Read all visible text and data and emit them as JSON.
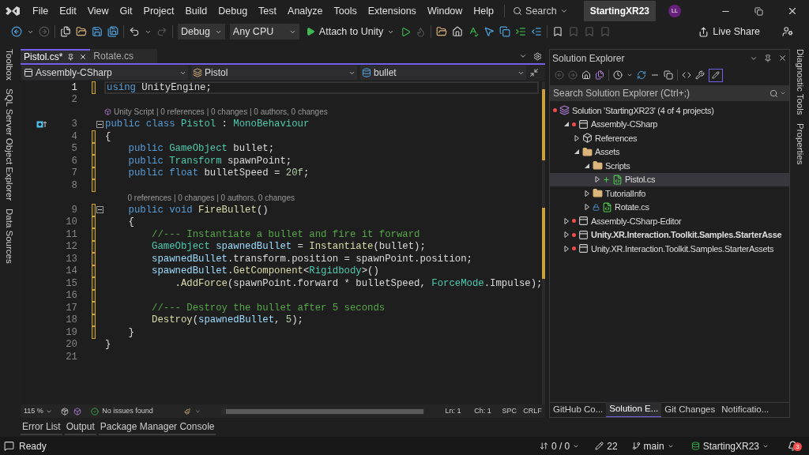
{
  "menu": [
    {
      "label": "File"
    },
    {
      "label": "Edit"
    },
    {
      "label": "View"
    },
    {
      "label": "Git"
    },
    {
      "label": "Project"
    },
    {
      "label": "Build"
    },
    {
      "label": "Debug"
    },
    {
      "label": "Test"
    },
    {
      "label": "Analyze"
    },
    {
      "label": "Tools"
    },
    {
      "label": "Extensions"
    },
    {
      "label": "Window"
    },
    {
      "label": "Help"
    }
  ],
  "search": {
    "label": "Search"
  },
  "solution_name": "StartingXR23",
  "avatar": "LL",
  "toolbar": {
    "configuration": "Debug",
    "platform": "Any CPU",
    "run": "Attach to Unity",
    "live_share": "Live Share"
  },
  "left_tool_tabs": [
    {
      "label": "Toolbox"
    },
    {
      "label": "SQL Server Object Explorer"
    },
    {
      "label": "Data Sources"
    }
  ],
  "right_tool_tabs": [
    {
      "label": "Diagnostic Tools"
    },
    {
      "label": "Properties"
    }
  ],
  "editor": {
    "tabs": [
      {
        "label": "Pistol.cs*",
        "selected": true
      },
      {
        "label": "Rotate.cs",
        "selected": false
      }
    ],
    "nav": {
      "project": "Assembly-CSharp",
      "type": "Pistol",
      "member": "bullet"
    },
    "lines": [
      {
        "n": "1",
        "changed": true,
        "fold": false,
        "current": true,
        "marker": false,
        "tokens": [
          {
            "text": "using",
            "kind": "kw"
          },
          {
            "text": " UnityEngine;",
            "kind": "plain"
          }
        ]
      },
      {
        "n": "2",
        "changed": false,
        "fold": false,
        "current": false,
        "marker": false
      },
      {
        "n": "3",
        "changed": false,
        "fold": true,
        "current": false,
        "marker": true,
        "lens": {
          "text": "Unity Script | 0 references | 0 changes | 0 authors, 0 changes",
          "kind": "unity"
        },
        "tokens": [
          {
            "text": "public class",
            "kind": "kw"
          },
          {
            "text": " Pistol",
            "kind": "type"
          },
          {
            "text": " : ",
            "kind": "plain"
          },
          {
            "text": "MonoBehaviour",
            "kind": "type"
          }
        ]
      },
      {
        "n": "4",
        "changed": true,
        "fold": false,
        "current": false,
        "marker": false,
        "tokens": [
          {
            "text": "{",
            "kind": "plain"
          }
        ]
      },
      {
        "n": "5",
        "changed": true,
        "fold": false,
        "current": false,
        "marker": false,
        "tokens": [
          {
            "text": "    public",
            "kind": "kw"
          },
          {
            "text": " GameObject",
            "kind": "type"
          },
          {
            "text": " bullet;",
            "kind": "plain"
          }
        ]
      },
      {
        "n": "6",
        "changed": true,
        "fold": false,
        "current": false,
        "marker": false,
        "tokens": [
          {
            "text": "    public",
            "kind": "kw"
          },
          {
            "text": " Transform",
            "kind": "type"
          },
          {
            "text": " spawnPoint;",
            "kind": "plain"
          }
        ]
      },
      {
        "n": "7",
        "changed": true,
        "fold": false,
        "current": false,
        "marker": false,
        "tokens": [
          {
            "text": "    public float",
            "kind": "kw"
          },
          {
            "text": " bulletSpeed = ",
            "kind": "plain"
          },
          {
            "text": "20f",
            "kind": "num"
          },
          {
            "text": ";",
            "kind": "plain"
          }
        ]
      },
      {
        "n": "8",
        "changed": true,
        "fold": false,
        "current": false,
        "marker": false
      },
      {
        "n": "9",
        "changed": true,
        "fold": true,
        "current": false,
        "marker": false,
        "lens": {
          "text": "0 references | 0 changes | 0 authors, 0 changes",
          "kind": "plain"
        },
        "tokens": [
          {
            "text": "    public void",
            "kind": "kw"
          },
          {
            "text": " FireBullet",
            "kind": "method"
          },
          {
            "text": "()",
            "kind": "plain"
          }
        ]
      },
      {
        "n": "10",
        "changed": true,
        "fold": false,
        "current": false,
        "marker": false,
        "tokens": [
          {
            "text": "    {",
            "kind": "plain"
          }
        ]
      },
      {
        "n": "11",
        "changed": true,
        "fold": false,
        "current": false,
        "marker": false,
        "tokens": [
          {
            "text": "        //--- Instantiate a bullet and fire it forward",
            "kind": "comment"
          }
        ]
      },
      {
        "n": "12",
        "changed": true,
        "fold": false,
        "current": false,
        "marker": false,
        "tokens": [
          {
            "text": "        GameObject",
            "kind": "type"
          },
          {
            "text": " spawnedBullet",
            "kind": "var"
          },
          {
            "text": " = ",
            "kind": "plain"
          },
          {
            "text": "Instantiate",
            "kind": "method"
          },
          {
            "text": "(bullet);",
            "kind": "plain"
          }
        ]
      },
      {
        "n": "13",
        "changed": true,
        "fold": false,
        "current": false,
        "marker": false,
        "tokens": [
          {
            "text": "        spawnedBullet",
            "kind": "var"
          },
          {
            "text": ".transform.position = spawnPoint.position;",
            "kind": "plain"
          }
        ]
      },
      {
        "n": "14",
        "changed": true,
        "fold": false,
        "current": false,
        "marker": false,
        "tokens": [
          {
            "text": "        spawnedBullet",
            "kind": "var"
          },
          {
            "text": ".",
            "kind": "plain"
          },
          {
            "text": "GetComponent",
            "kind": "method"
          },
          {
            "text": "<",
            "kind": "plain"
          },
          {
            "text": "Rigidbody",
            "kind": "type"
          },
          {
            "text": ">()",
            "kind": "plain"
          }
        ]
      },
      {
        "n": "15",
        "changed": true,
        "fold": false,
        "current": false,
        "marker": false,
        "tokens": [
          {
            "text": "            .",
            "kind": "plain"
          },
          {
            "text": "AddForce",
            "kind": "method"
          },
          {
            "text": "(spawnPoint.forward * bulletSpeed, ",
            "kind": "plain"
          },
          {
            "text": "ForceMode",
            "kind": "type"
          },
          {
            "text": ".Impulse);",
            "kind": "plain"
          }
        ]
      },
      {
        "n": "16",
        "changed": true,
        "fold": false,
        "current": false,
        "marker": false
      },
      {
        "n": "17",
        "changed": true,
        "fold": false,
        "current": false,
        "marker": false,
        "tokens": [
          {
            "text": "        //--- Destroy the bullet after 5 seconds",
            "kind": "comment"
          }
        ]
      },
      {
        "n": "18",
        "changed": true,
        "fold": false,
        "current": false,
        "marker": false,
        "tokens": [
          {
            "text": "        Destroy",
            "kind": "method"
          },
          {
            "text": "(",
            "kind": "plain"
          },
          {
            "text": "spawnedBullet",
            "kind": "var"
          },
          {
            "text": ", ",
            "kind": "plain"
          },
          {
            "text": "5",
            "kind": "num"
          },
          {
            "text": ");",
            "kind": "plain"
          }
        ]
      },
      {
        "n": "19",
        "changed": true,
        "fold": false,
        "current": false,
        "marker": false,
        "tokens": [
          {
            "text": "    }",
            "kind": "plain"
          }
        ]
      },
      {
        "n": "20",
        "changed": false,
        "fold": false,
        "current": false,
        "marker": false,
        "tokens": [
          {
            "text": "}",
            "kind": "plain"
          }
        ]
      },
      {
        "n": "21",
        "changed": false,
        "fold": false,
        "current": false,
        "marker": false
      }
    ],
    "status": {
      "zoom": "115 %",
      "issues": "No issues found",
      "line": "Ln: 1",
      "column": "Ch: 1",
      "whitespace": "SPC",
      "line_endings": "CRLF"
    }
  },
  "solution_explorer": {
    "title": "Solution Explorer",
    "search": {
      "placeholder": "Search Solution Explorer (Ctrl+;)"
    },
    "tree": [
      {
        "label": "Solution 'StartingXR23' (4 of 4 projects)",
        "kind": "solution",
        "pending": true,
        "selected": false,
        "children": [
          {
            "label": "Assembly-CSharp",
            "kind": "project",
            "pending": true,
            "bold": false,
            "expanded": true,
            "selected": false,
            "children": [
              {
                "label": "References",
                "kind": "references",
                "expanded": false,
                "selected": false
              },
              {
                "label": "Assets",
                "kind": "folder",
                "expanded": true,
                "selected": false,
                "children": [
                  {
                    "label": "Scripts",
                    "kind": "folder",
                    "expanded": true,
                    "selected": false,
                    "children": [
                      {
                        "label": "Pistol.cs",
                        "kind": "csharp",
                        "added": true,
                        "locked": false,
                        "expanded": false,
                        "selected": true
                      }
                    ]
                  },
                  {
                    "label": "TutorialInfo",
                    "kind": "folder",
                    "expanded": false,
                    "selected": false
                  },
                  {
                    "label": "Rotate.cs",
                    "kind": "csharp",
                    "added": false,
                    "locked": true,
                    "expanded": false,
                    "selected": false
                  }
                ]
              }
            ]
          },
          {
            "label": "Assembly-CSharp-Editor",
            "kind": "project",
            "pending": true,
            "bold": false,
            "expanded": false,
            "selected": false
          },
          {
            "label": "Unity.XR.Interaction.Toolkit.Samples.StarterAsse",
            "kind": "project",
            "pending": true,
            "bold": true,
            "expanded": false,
            "selected": false
          },
          {
            "label": "Unity.XR.Interaction.Toolkit.Samples.StarterAssets",
            "kind": "project",
            "pending": true,
            "bold": false,
            "expanded": false,
            "selected": false
          }
        ]
      }
    ],
    "tabs": [
      {
        "label": "GitHub Co...",
        "selected": false
      },
      {
        "label": "Solution E...",
        "selected": true
      },
      {
        "label": "Git Changes",
        "selected": false
      },
      {
        "label": "Notificatio...",
        "selected": false
      }
    ]
  },
  "bottom_tabs": [
    {
      "label": "Error List"
    },
    {
      "label": "Output"
    },
    {
      "label": "Package Manager Console"
    }
  ],
  "status_bar": {
    "message": "Ready",
    "sync": "0 / 0",
    "changes": "22",
    "branch": "main",
    "repository": "StartingXR23",
    "notifications": "3"
  }
}
